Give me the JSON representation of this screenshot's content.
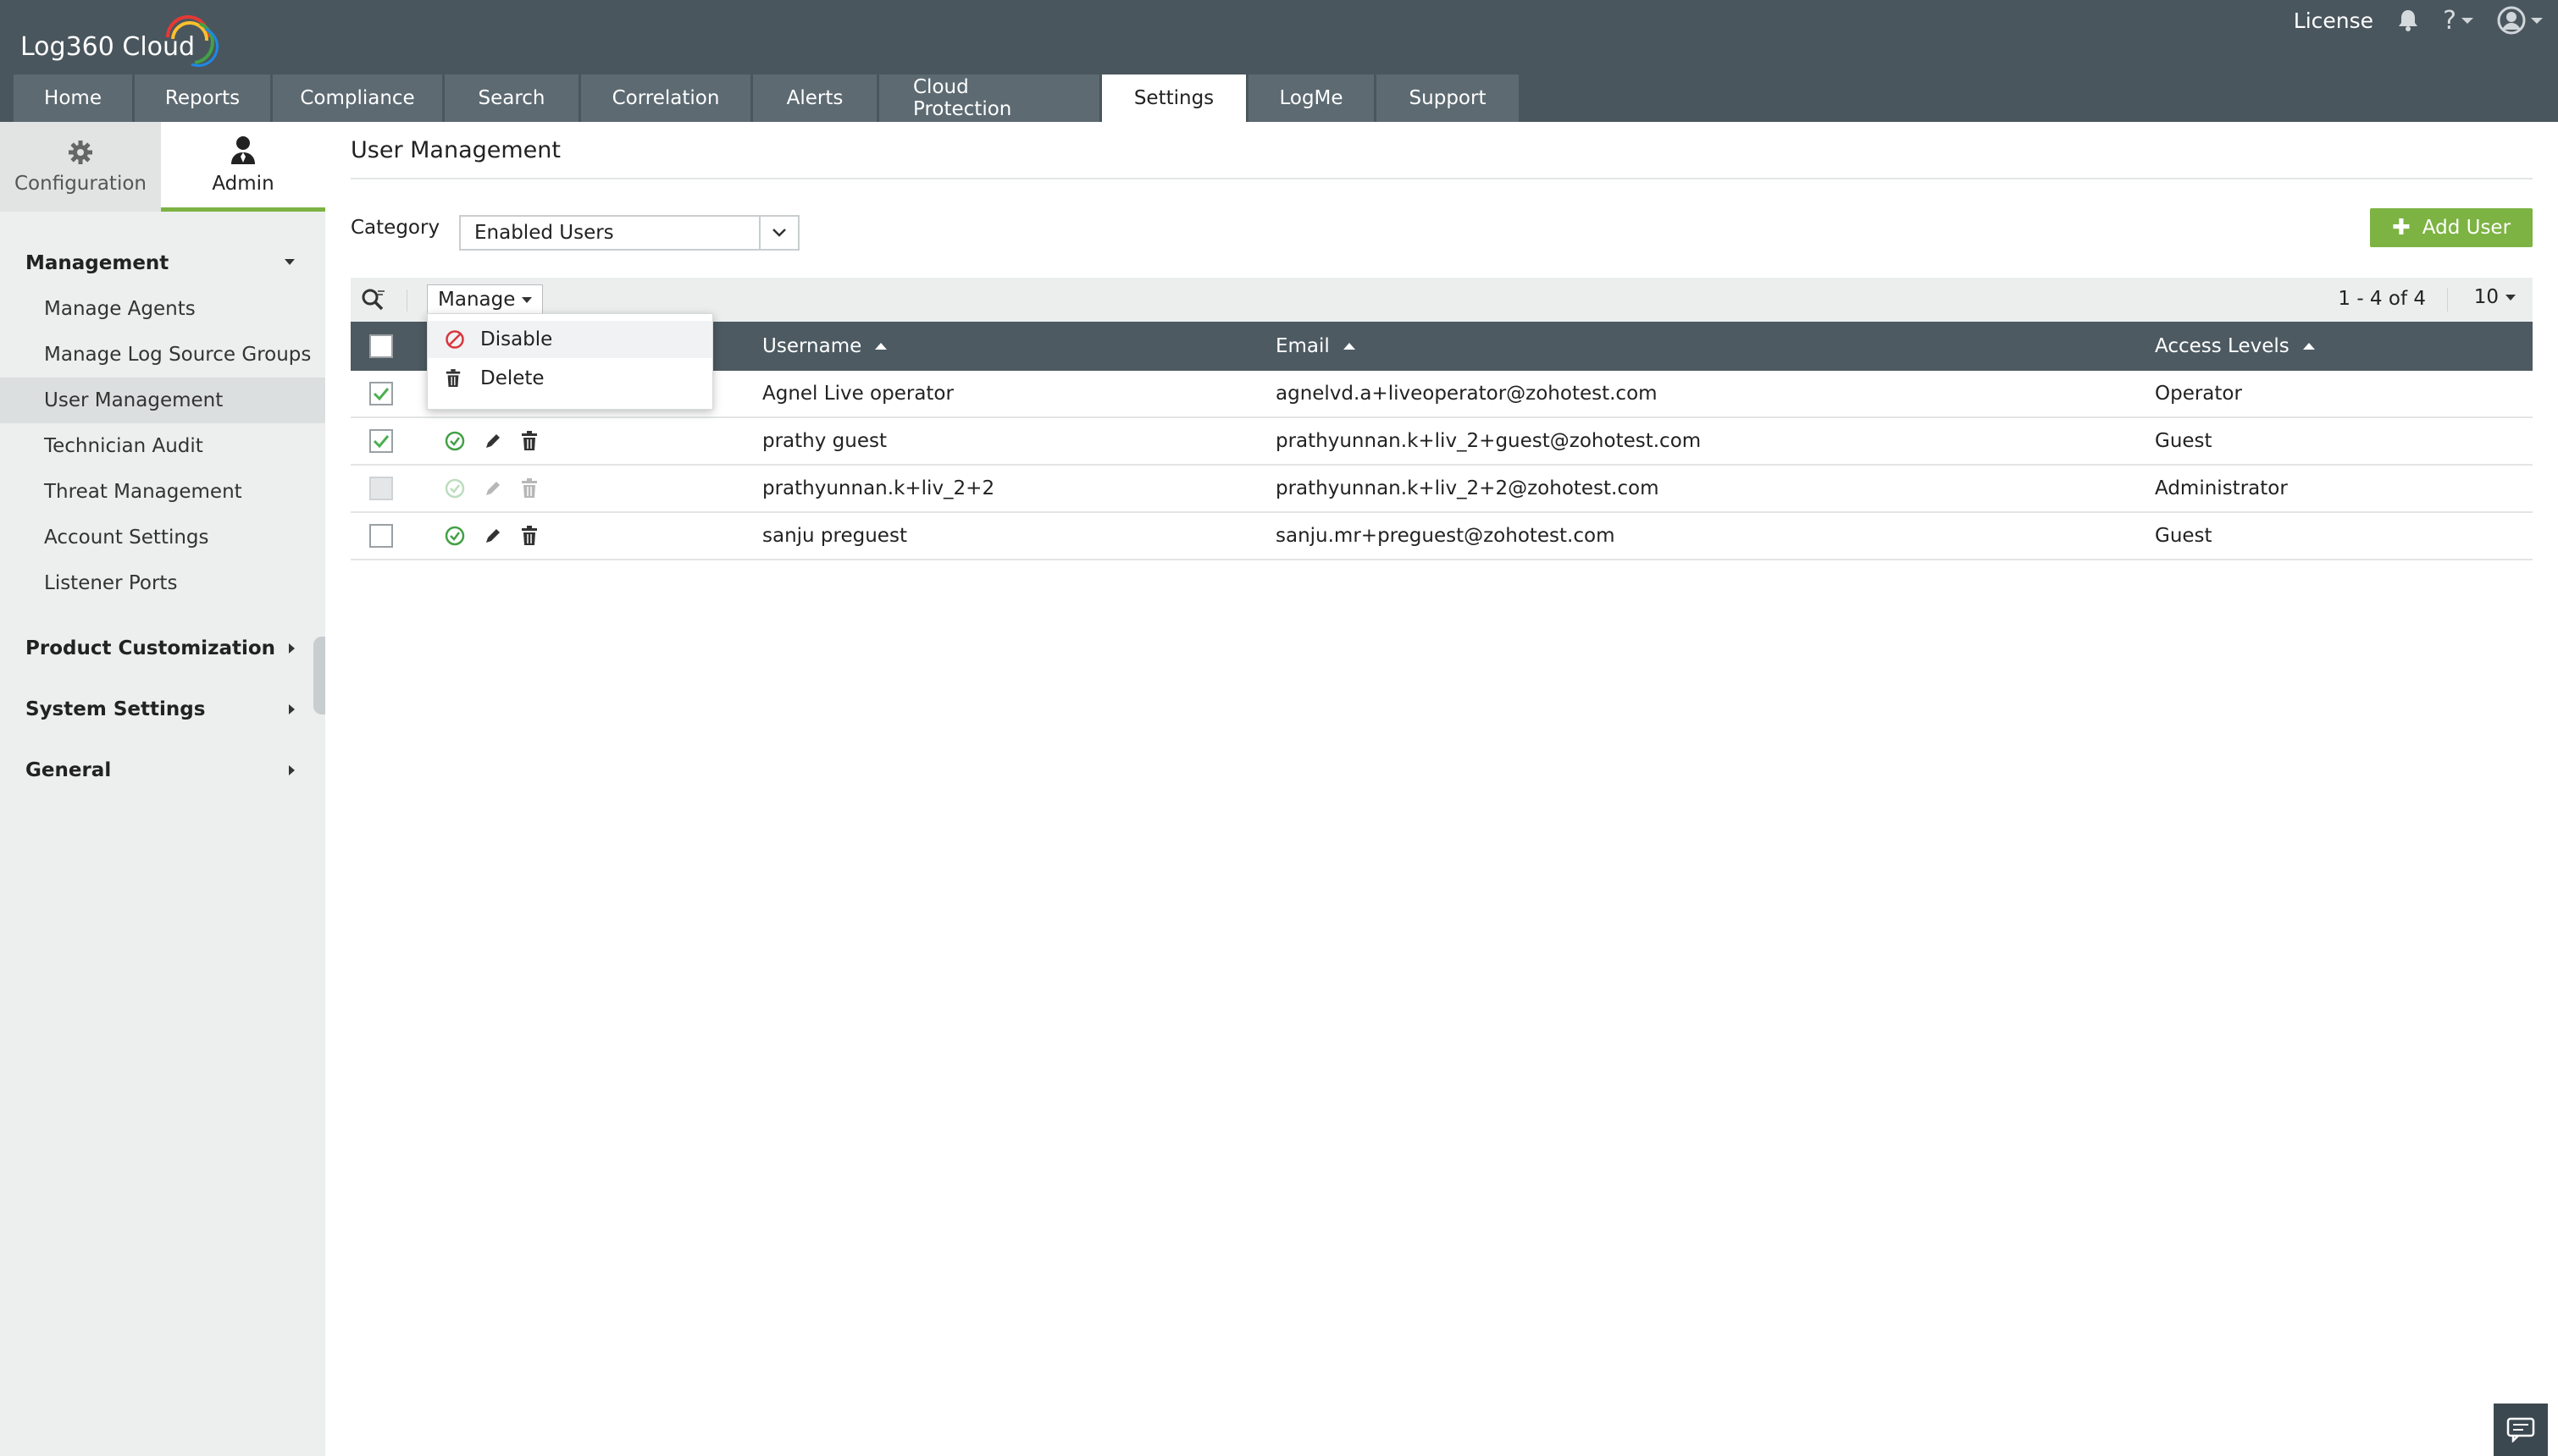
{
  "app": {
    "logo_text": "Log360 Cloud"
  },
  "top_right": {
    "license": "License",
    "help": "?"
  },
  "tabs": [
    {
      "label": "Home"
    },
    {
      "label": "Reports"
    },
    {
      "label": "Compliance"
    },
    {
      "label": "Search"
    },
    {
      "label": "Correlation"
    },
    {
      "label": "Alerts"
    },
    {
      "label": "Cloud Protection"
    },
    {
      "label": "Settings",
      "active": true
    },
    {
      "label": "LogMe"
    },
    {
      "label": "Support"
    }
  ],
  "subtabs": {
    "configuration": "Configuration",
    "admin": "Admin"
  },
  "sidebar": {
    "management": "Management",
    "items": [
      {
        "label": "Manage Agents"
      },
      {
        "label": "Manage Log Source Groups"
      },
      {
        "label": "User Management",
        "active": true
      },
      {
        "label": "Technician Audit"
      },
      {
        "label": "Threat Management"
      },
      {
        "label": "Account Settings"
      },
      {
        "label": "Listener Ports"
      }
    ],
    "groups": [
      "Product Customization",
      "System Settings",
      "General"
    ]
  },
  "main": {
    "title": "User Management",
    "category_label": "Category",
    "category_value": "Enabled Users",
    "add_user": "Add User",
    "manage_label": "Manage",
    "pager_text": "1 - 4 of 4",
    "page_size": "10",
    "manage_menu": {
      "disable": "Disable",
      "delete": "Delete"
    },
    "columns": {
      "username": "Username",
      "email": "Email",
      "access_levels": "Access Levels"
    },
    "rows": [
      {
        "username": "Agnel Live operator",
        "email": "agnelvd.a+liveoperator@zohotest.com",
        "access": "Operator",
        "checked": true,
        "disabled": false
      },
      {
        "username": "prathy guest",
        "email": "prathyunnan.k+liv_2+guest@zohotest.com",
        "access": "Guest",
        "checked": true,
        "disabled": false
      },
      {
        "username": "prathyunnan.k+liv_2+2",
        "email": "prathyunnan.k+liv_2+2@zohotest.com",
        "access": "Administrator",
        "checked": false,
        "disabled": true
      },
      {
        "username": "sanju preguest",
        "email": "sanju.mr+preguest@zohotest.com",
        "access": "Guest",
        "checked": false,
        "disabled": false
      }
    ]
  },
  "colors": {
    "topbar": "#4a565e",
    "tab": "#5d6a72",
    "accent_green": "#7cb342",
    "table_header": "#4d5a62",
    "danger": "#d9363e"
  }
}
